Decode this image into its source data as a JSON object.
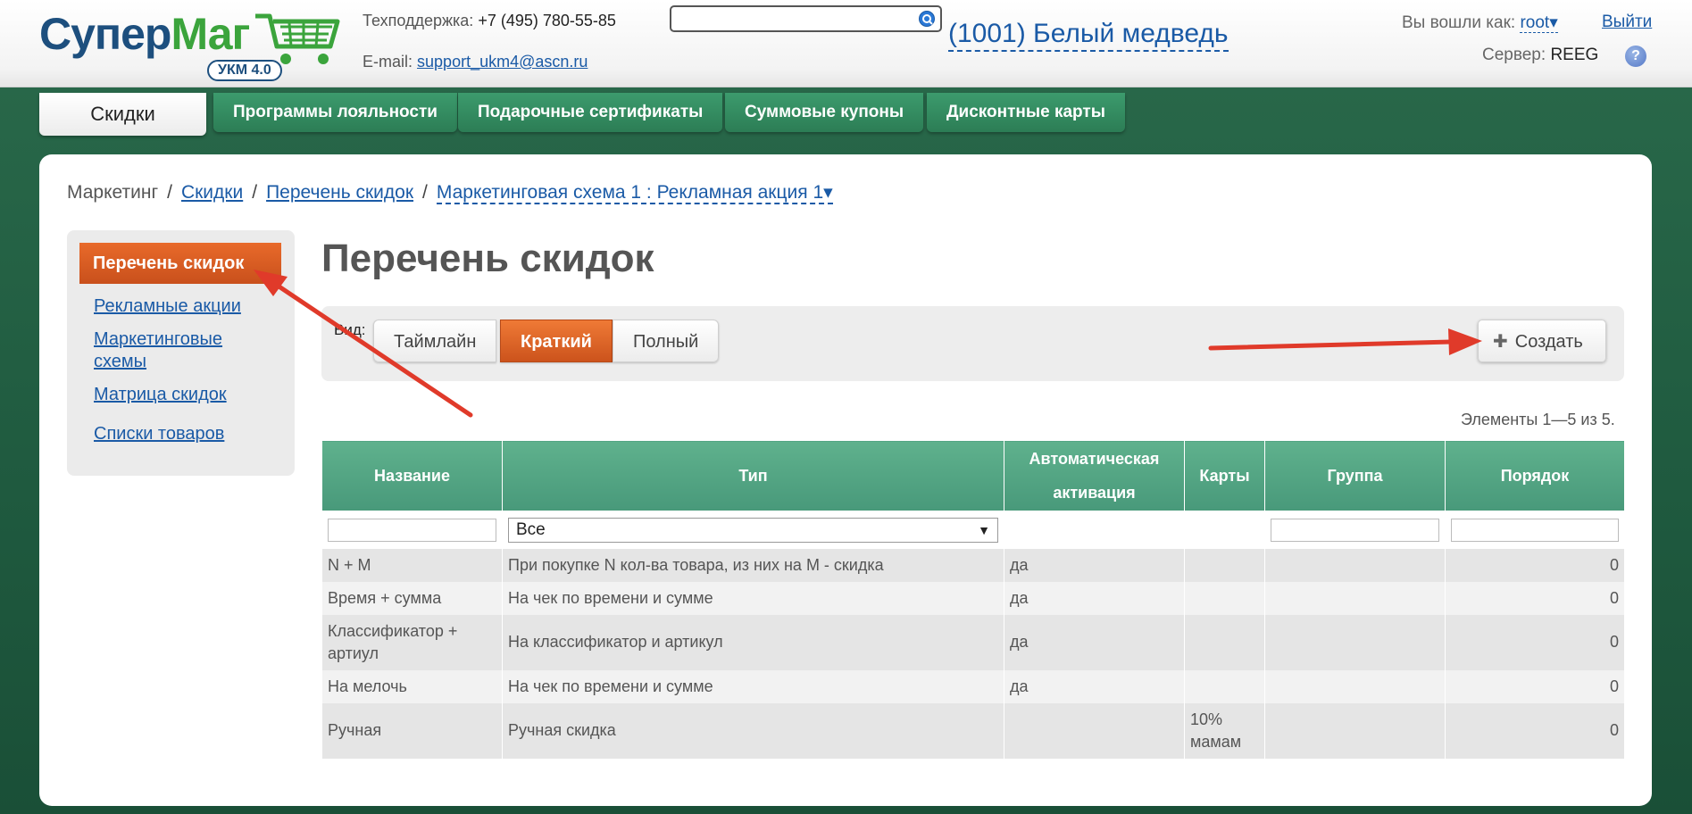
{
  "header": {
    "logo_text_1": "Супер",
    "logo_text_2": "Маг",
    "logo_badge": "УКМ 4.0",
    "support_label": "Техподдержка:",
    "support_phone": "+7 (495) 780-55-85",
    "email_label": "E-mail:",
    "email": "support_ukm4@ascn.ru",
    "search_value": "",
    "shop_name": "(1001) Белый медведь",
    "logged_in_label": "Вы вошли как:",
    "username": "root",
    "username_arrow": "▾",
    "logout": "Выйти",
    "server_label": "Сервер:",
    "server_name": "REEG",
    "help_glyph": "?"
  },
  "tabs": [
    {
      "label": "Скидки",
      "active": true
    },
    {
      "label": "Программы лояльности"
    },
    {
      "label": "Подарочные сертификаты"
    },
    {
      "label": "Суммовые купоны"
    },
    {
      "label": "Дисконтные карты"
    }
  ],
  "breadcrumb": {
    "root": "Маркетинг",
    "sep": "/",
    "item1": "Скидки",
    "item2": "Перечень скидок",
    "item3": "Маркетинговая схема 1 : Рекламная акция 1",
    "item3_arrow": "▾"
  },
  "sidebar": {
    "active": "Перечень скидок",
    "items": [
      "Рекламные акции",
      "Маркетинговые схемы",
      "Матрица скидок",
      "Списки товаров"
    ]
  },
  "page_title": "Перечень скидок",
  "toolbar": {
    "view_label": "Вид:",
    "views": [
      "Таймлайн",
      "Краткий",
      "Полный"
    ],
    "active_view": "Краткий",
    "create_icon": "plus-icon",
    "create_plus": "✚",
    "create_label": "Создать"
  },
  "count_text": "Элементы 1—5 из 5.",
  "table": {
    "columns": [
      "Название",
      "Тип",
      "Автоматическая активация",
      "Карты",
      "Группа",
      "Порядок"
    ],
    "filter": {
      "name": "",
      "type_selected": "Все",
      "type_arrow": "▼",
      "group": "",
      "order": ""
    },
    "rows": [
      {
        "name": "N + M",
        "type": "При покупке N кол-ва товара, из них на M - скидка",
        "auto": "да",
        "cards": "",
        "group": "",
        "order": "0"
      },
      {
        "name": "Время + сумма",
        "type": "На чек по времени и сумме",
        "auto": "да",
        "cards": "",
        "group": "",
        "order": "0"
      },
      {
        "name": "Классификатор + артиул",
        "type": "На классификатор и артикул",
        "auto": "да",
        "cards": "",
        "group": "",
        "order": "0"
      },
      {
        "name": "На мелочь",
        "type": "На чек по времени и сумме",
        "auto": "да",
        "cards": "",
        "group": "",
        "order": "0"
      },
      {
        "name": "Ручная",
        "type": "Ручная скидка",
        "auto": "",
        "cards": "10% мамам",
        "group": "",
        "order": "0"
      }
    ]
  },
  "colors": {
    "brand_green": "#2c7d55",
    "accent_orange": "#cc531c",
    "link_blue": "#1a5aa6",
    "table_header": "#5fb18d",
    "annotation_red": "#e03a2a"
  }
}
